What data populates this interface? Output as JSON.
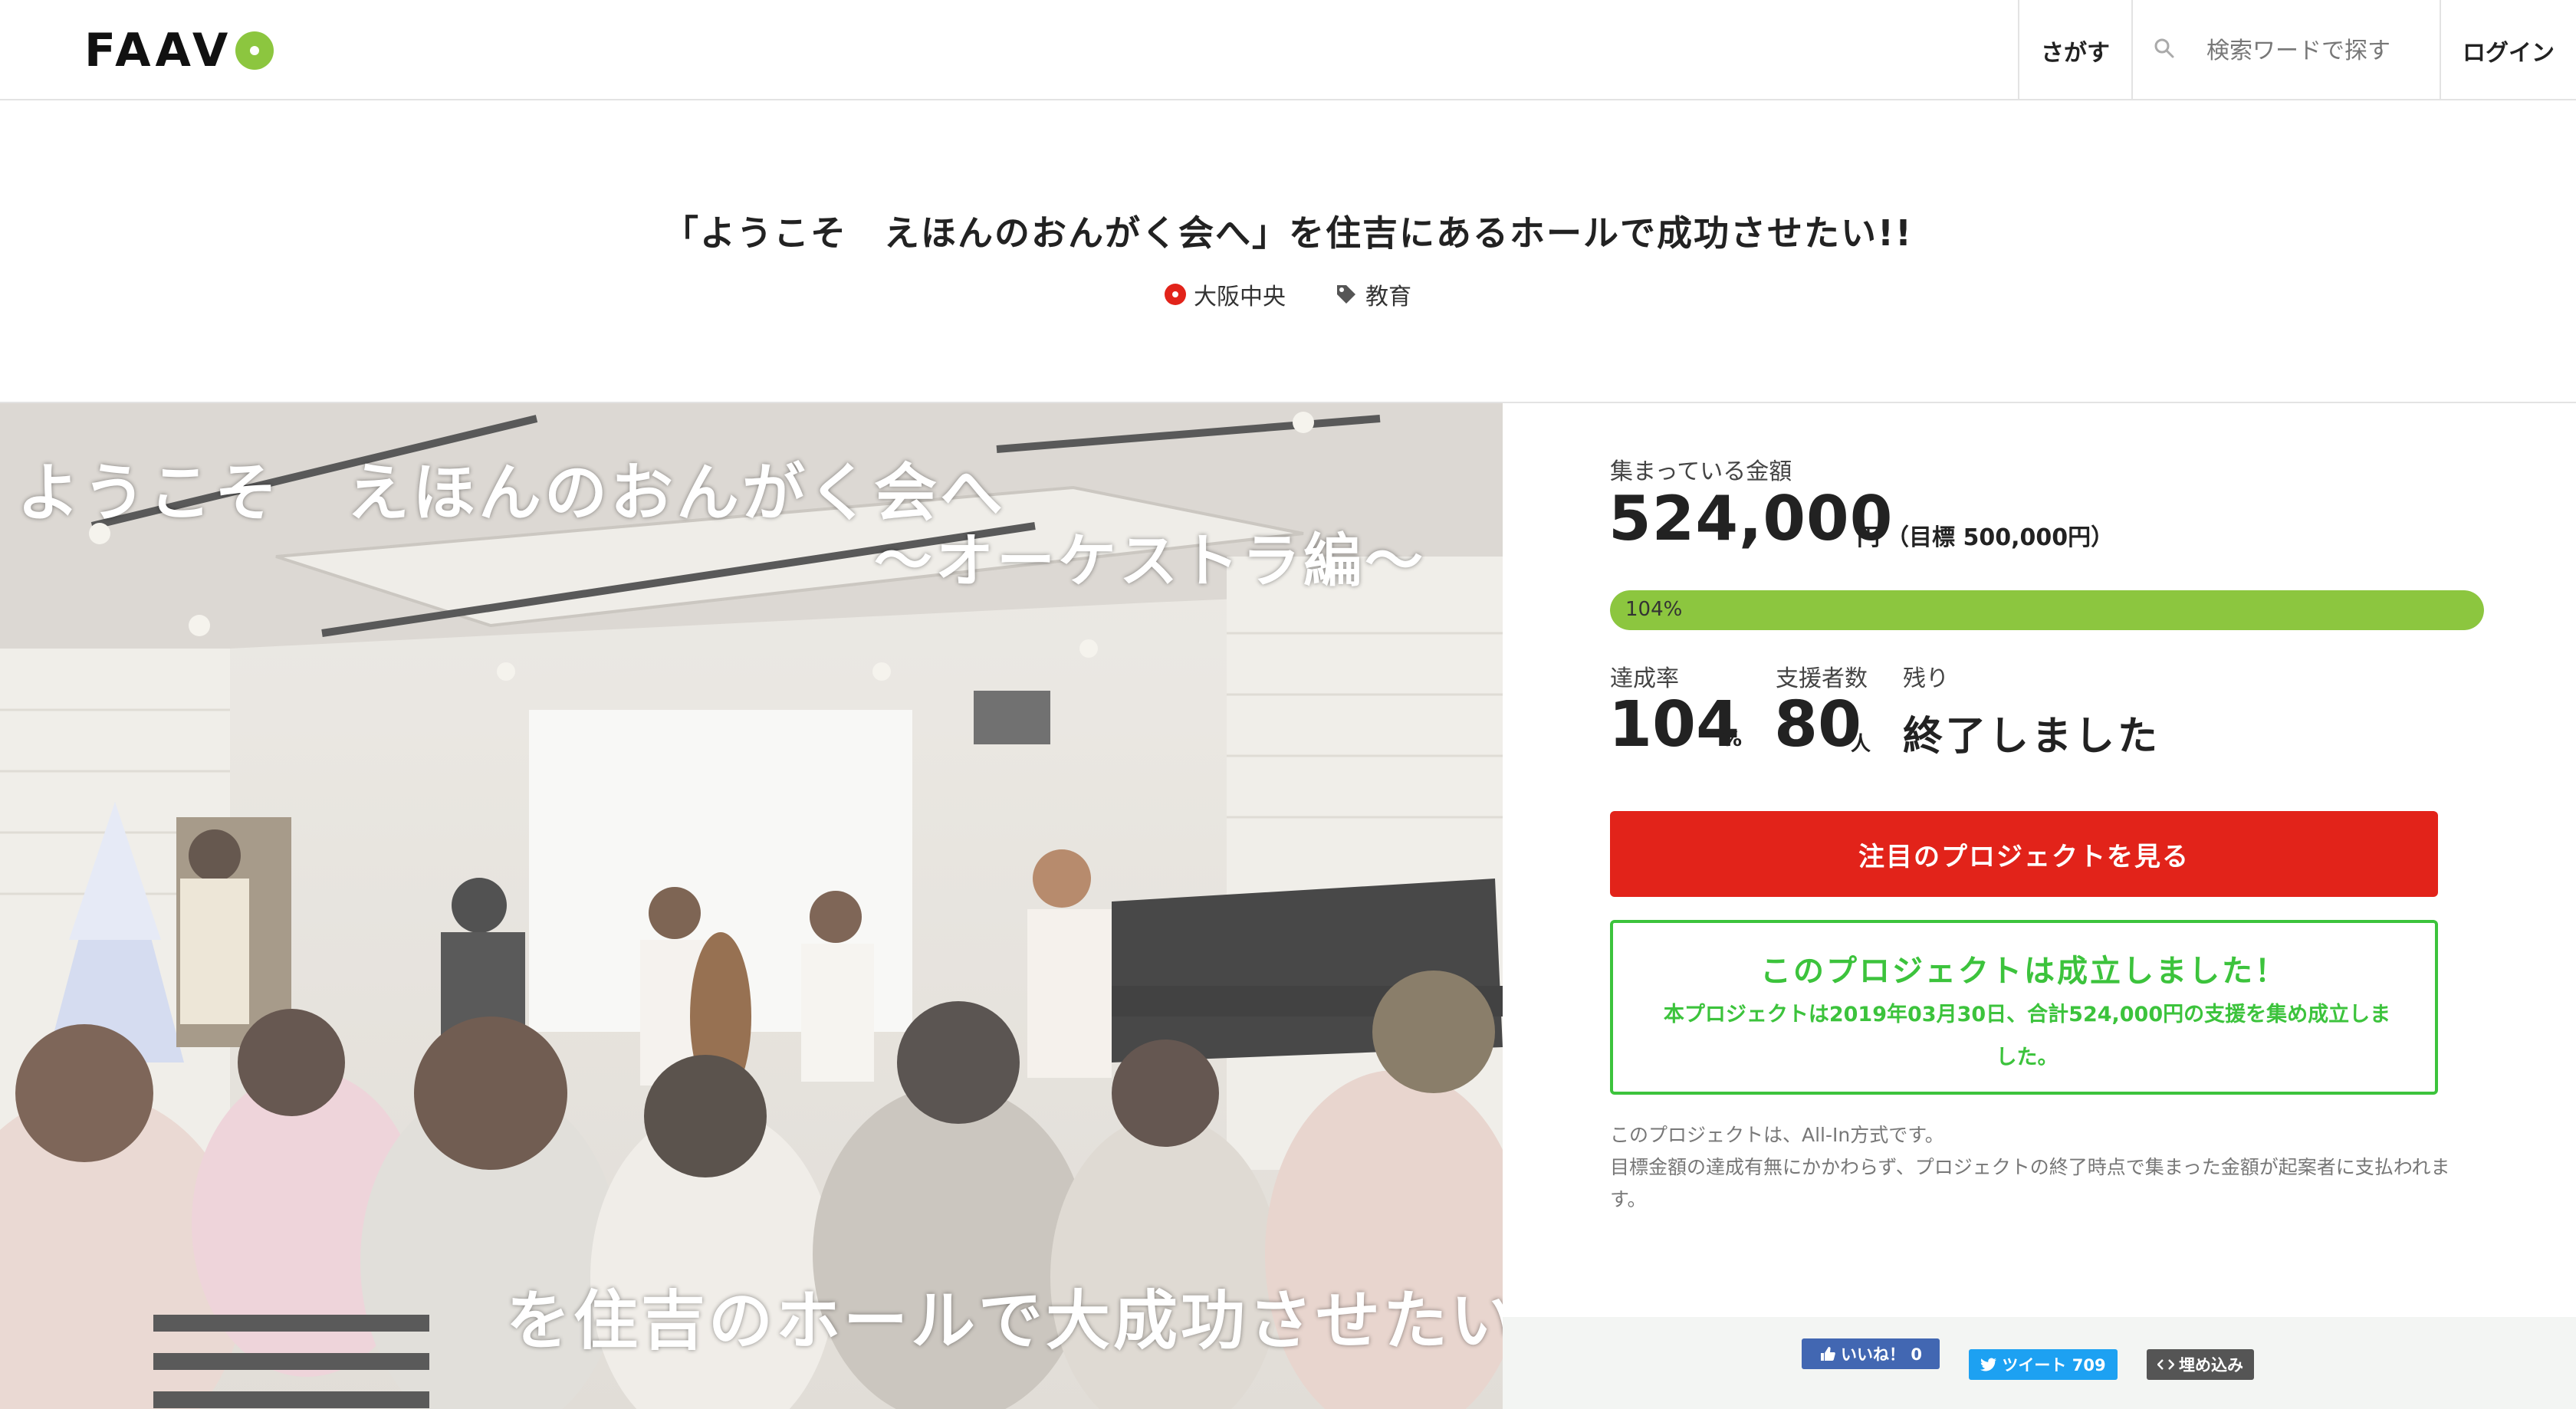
{
  "header": {
    "logo": "FAAVO",
    "nav_search": "さがす",
    "search_placeholder": "検索ワードで探す",
    "login": "ログイン"
  },
  "project": {
    "title": "「ようこそ　えほんのおんがく会へ」を住吉にあるホールで成功させたい!!",
    "location": "大阪中央",
    "category": "教育"
  },
  "hero": {
    "line1": "ようこそ　えほんのおんがく会へ",
    "line2": "～オーケストラ編～",
    "line3": "を住吉のホールで大成功させたい！"
  },
  "stats": {
    "collected_label": "集まっている金額",
    "collected_value": "524,000",
    "collected_unit": "円",
    "goal_text": "（目標 500,000円）",
    "progress_percent": 104,
    "progress_label": "104%",
    "rate_label": "達成率",
    "rate_value": "104",
    "rate_unit": "%",
    "supporters_label": "支援者数",
    "supporters_value": "80",
    "supporters_unit": "人",
    "remaining_label": "残り",
    "remaining_value": "終了しました"
  },
  "cta": {
    "label": "注目のプロジェクトを見る"
  },
  "success": {
    "heading": "このプロジェクトは成立しました！",
    "body": "本プロジェクトは2019年03月30日、合計524,000円の支援を集め成立しました。"
  },
  "note": {
    "line1": "このプロジェクトは、All-In方式です。",
    "line2": "目標金額の達成有無にかかわらず、プロジェクトの終了時点で集まった金額が起案者に支払われます。"
  },
  "share": {
    "like": "いいね！ 0",
    "tweet": "ツイート 709",
    "embed": "埋め込み"
  },
  "colors": {
    "accent_green": "#8cc63f",
    "cta_red": "#e2231a",
    "success_green": "#3cc33c"
  }
}
